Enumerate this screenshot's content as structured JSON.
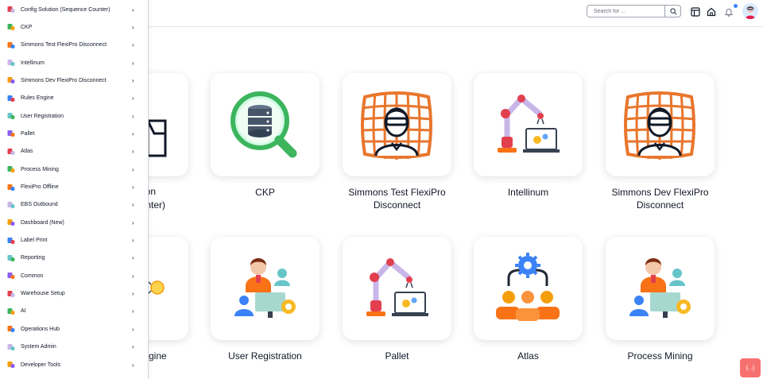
{
  "header": {
    "search_placeholder": "Search for ...",
    "icons": [
      "search-icon",
      "layout-icon",
      "home-icon",
      "bell-icon",
      "avatar"
    ]
  },
  "sidebar": {
    "items": [
      {
        "label": "Config Solution (Sequence Counter)",
        "icon": "config-icon"
      },
      {
        "label": "CKP",
        "icon": "database-search-icon"
      },
      {
        "label": "Simmons Test FlexiPro Disconnect",
        "icon": "app-icon"
      },
      {
        "label": "Intellinum",
        "icon": "robot-arm-icon"
      },
      {
        "label": "Simmons Dev FlexiPro Disconnect",
        "icon": "app-icon"
      },
      {
        "label": "Rules Engine",
        "icon": "rules-icon"
      },
      {
        "label": "User Registration",
        "icon": "user-icon"
      },
      {
        "label": "Pallet",
        "icon": "robot-arm-icon"
      },
      {
        "label": "Atlas",
        "icon": "team-icon"
      },
      {
        "label": "Process Mining",
        "icon": "process-icon"
      },
      {
        "label": "FlexiPro Offline",
        "icon": "offline-icon"
      },
      {
        "label": "EBS Outbound",
        "icon": "outbound-icon"
      },
      {
        "label": "Dashboard (New)",
        "icon": "dashboard-icon"
      },
      {
        "label": "Label Print",
        "icon": "label-icon"
      },
      {
        "label": "Reporting",
        "icon": "reporting-icon"
      },
      {
        "label": "Common",
        "icon": "common-icon"
      },
      {
        "label": "Warehouse Setup",
        "icon": "warehouse-icon"
      },
      {
        "label": "AI",
        "icon": "ai-icon"
      },
      {
        "label": "Operations Hub",
        "icon": "hub-icon"
      },
      {
        "label": "System Admin",
        "icon": "admin-icon"
      },
      {
        "label": "Developer Tools",
        "icon": "devtools-icon"
      }
    ],
    "chevron": "›"
  },
  "cards": {
    "row1": [
      {
        "title": "Config Solution (Sequence Counter)",
        "visible_title_line1": "ution",
        "visible_title_line2": "ounter)"
      },
      {
        "title": "CKP"
      },
      {
        "title_line1": "Simmons Test FlexiPro",
        "title_line2": "Disconnect"
      },
      {
        "title": "Intellinum"
      },
      {
        "title_line1": "Simmons Dev FlexiPro",
        "title_line2": "Disconnect"
      }
    ],
    "row2": [
      {
        "visible_title": "gine"
      },
      {
        "title": "User Registration"
      },
      {
        "title": "Pallet"
      },
      {
        "title": "Atlas"
      },
      {
        "title": "Process Mining"
      }
    ]
  },
  "fab": {
    "label": "{...}"
  },
  "colors": {
    "orange": "#e8762d",
    "green": "#3cb55d",
    "purple": "#c9b6e8",
    "red": "#e2404f",
    "teal": "#67c5c9",
    "yellow": "#f8b923"
  }
}
